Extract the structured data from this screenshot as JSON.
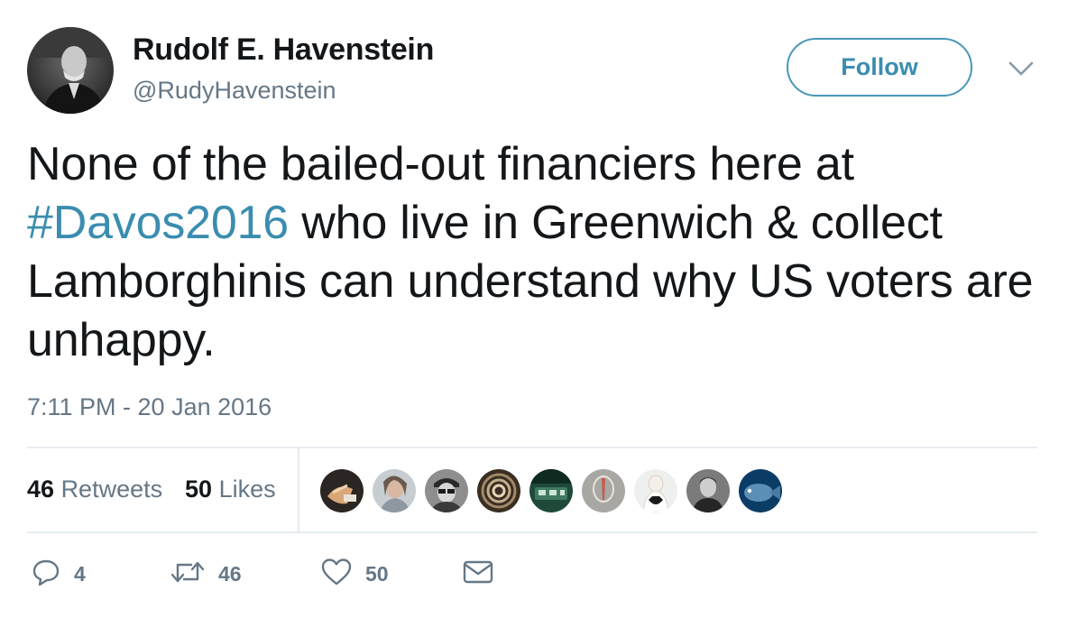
{
  "author": {
    "display_name": "Rudolf E. Havenstein",
    "screen_name": "@RudyHavenstein"
  },
  "follow_label": "Follow",
  "tweet": {
    "text_before": "None of the bailed-out financiers here at ",
    "hashtag": "#Davos2016",
    "text_after": " who live in Greenwich & collect Lamborghinis can understand why US voters are unhappy.",
    "timestamp": "7:11 PM - 20 Jan 2016"
  },
  "stats": {
    "retweets_count": "46",
    "retweets_label": "Retweets",
    "likes_count": "50",
    "likes_label": "Likes"
  },
  "actions": {
    "reply_count": "4",
    "retweet_count": "46",
    "like_count": "50"
  },
  "colors": {
    "link": "#3b8db0",
    "secondary_text": "#657786",
    "primary_text": "#14171a",
    "divider": "#e6ecf0"
  },
  "icons": {
    "reply": "reply-icon",
    "retweet": "retweet-icon",
    "like": "heart-icon",
    "dm": "envelope-icon",
    "caret": "chevron-down-icon"
  }
}
